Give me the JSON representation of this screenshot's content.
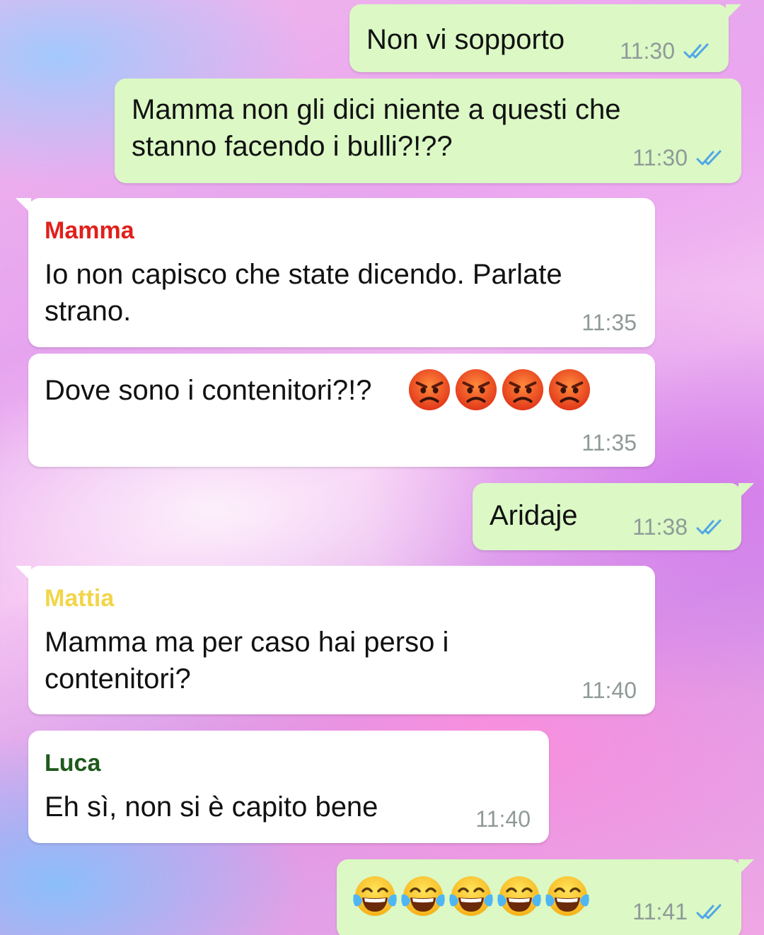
{
  "colors": {
    "outgoing_bubble": "#dbf8c5",
    "incoming_bubble": "#ffffff",
    "read_ticks": "#4fa6e8",
    "timestamp": "#8f9a98",
    "sender_mamma": "#e0201b",
    "sender_mattia": "#f2d54a",
    "sender_luca": "#1e5a1c"
  },
  "messages": [
    {
      "direction": "out",
      "text": "Non vi sopporto",
      "time": "11:30",
      "status_icon": "double-check-read-icon"
    },
    {
      "direction": "out",
      "text": "Mamma non gli dici niente a questi che\nstanno facendo i bulli?!??",
      "time": "11:30",
      "status_icon": "double-check-read-icon"
    },
    {
      "direction": "in",
      "sender": "Mamma",
      "text": "Io non capisco che state dicendo. Parlate\nstrano.",
      "time": "11:35"
    },
    {
      "direction": "in",
      "text": "Dove sono i contenitori?!?",
      "emoji": [
        "pouting-face-emoji",
        "pouting-face-emoji",
        "pouting-face-emoji",
        "pouting-face-emoji"
      ],
      "time": "11:35"
    },
    {
      "direction": "out",
      "text": "Aridaje",
      "time": "11:38",
      "status_icon": "double-check-read-icon"
    },
    {
      "direction": "in",
      "sender": "Mattia",
      "text": "Mamma ma per caso hai perso i\ncontenitori?",
      "time": "11:40"
    },
    {
      "direction": "in",
      "sender": "Luca",
      "text": "Eh sì, non si è capito bene",
      "time": "11:40"
    },
    {
      "direction": "out",
      "emoji": [
        "tears-of-joy-emoji",
        "tears-of-joy-emoji",
        "tears-of-joy-emoji",
        "tears-of-joy-emoji",
        "tears-of-joy-emoji"
      ],
      "time": "11:41",
      "status_icon": "double-check-read-icon"
    }
  ]
}
